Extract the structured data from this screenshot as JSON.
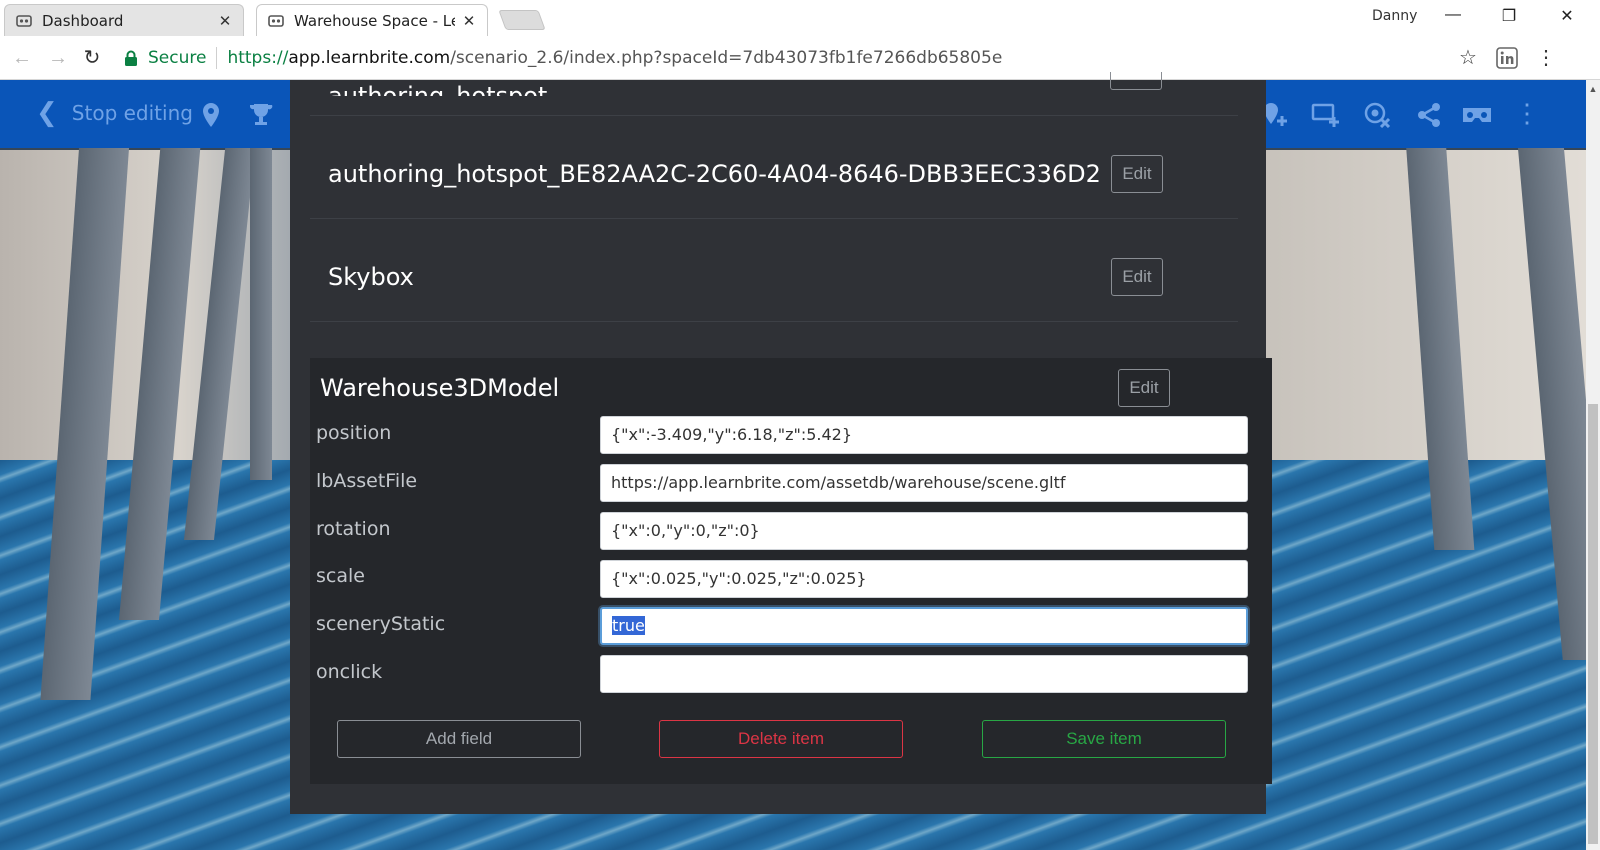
{
  "browser": {
    "tabs": [
      {
        "title": "Dashboard",
        "active": false
      },
      {
        "title": "Warehouse Space - Learr",
        "active": true
      }
    ],
    "profile_name": "Danny",
    "secure_label": "Secure",
    "url": {
      "scheme": "https://",
      "host": "app.learnbrite.com",
      "path": "/scenario_2.6/index.php?spaceId=7db43073fb1fe7266db65805e"
    }
  },
  "app_bar": {
    "stop_editing_label": "Stop editing",
    "icons": [
      "location-pin-icon",
      "trophy-icon",
      "add-location-icon",
      "add-screen-icon",
      "remove-target-icon",
      "share-icon",
      "vr-headset-icon",
      "more-vertical-icon"
    ]
  },
  "items": [
    {
      "title": "authoring_hotspot_",
      "edit_label": "Edit"
    },
    {
      "title": "authoring_hotspot_BE82AA2C-2C60-4A04-8646-DBB3EEC336D2",
      "edit_label": "Edit"
    },
    {
      "title": "Skybox",
      "edit_label": "Edit"
    }
  ],
  "expanded_item": {
    "title": "Warehouse3DModel",
    "edit_label": "Edit",
    "fields": [
      {
        "label": "position",
        "value": "{\"x\":-3.409,\"y\":6.18,\"z\":5.42}"
      },
      {
        "label": "lbAssetFile",
        "value": "https://app.learnbrite.com/assetdb/warehouse/scene.gltf"
      },
      {
        "label": "rotation",
        "value": "{\"x\":0,\"y\":0,\"z\":0}"
      },
      {
        "label": "scale",
        "value": "{\"x\":0.025,\"y\":0.025,\"z\":0.025}"
      },
      {
        "label": "sceneryStatic",
        "value": "true",
        "focused": true,
        "selected": true
      },
      {
        "label": "onclick",
        "value": ""
      }
    ],
    "actions": {
      "add_field": "Add field",
      "delete_item": "Delete item",
      "save_item": "Save item"
    }
  },
  "colors": {
    "app_bar": "#0a55b8",
    "modal_bg": "#2f3136",
    "expanded_bg": "#25272b",
    "delete": "#dc3545",
    "save": "#28a745",
    "secure": "#0b8043"
  }
}
